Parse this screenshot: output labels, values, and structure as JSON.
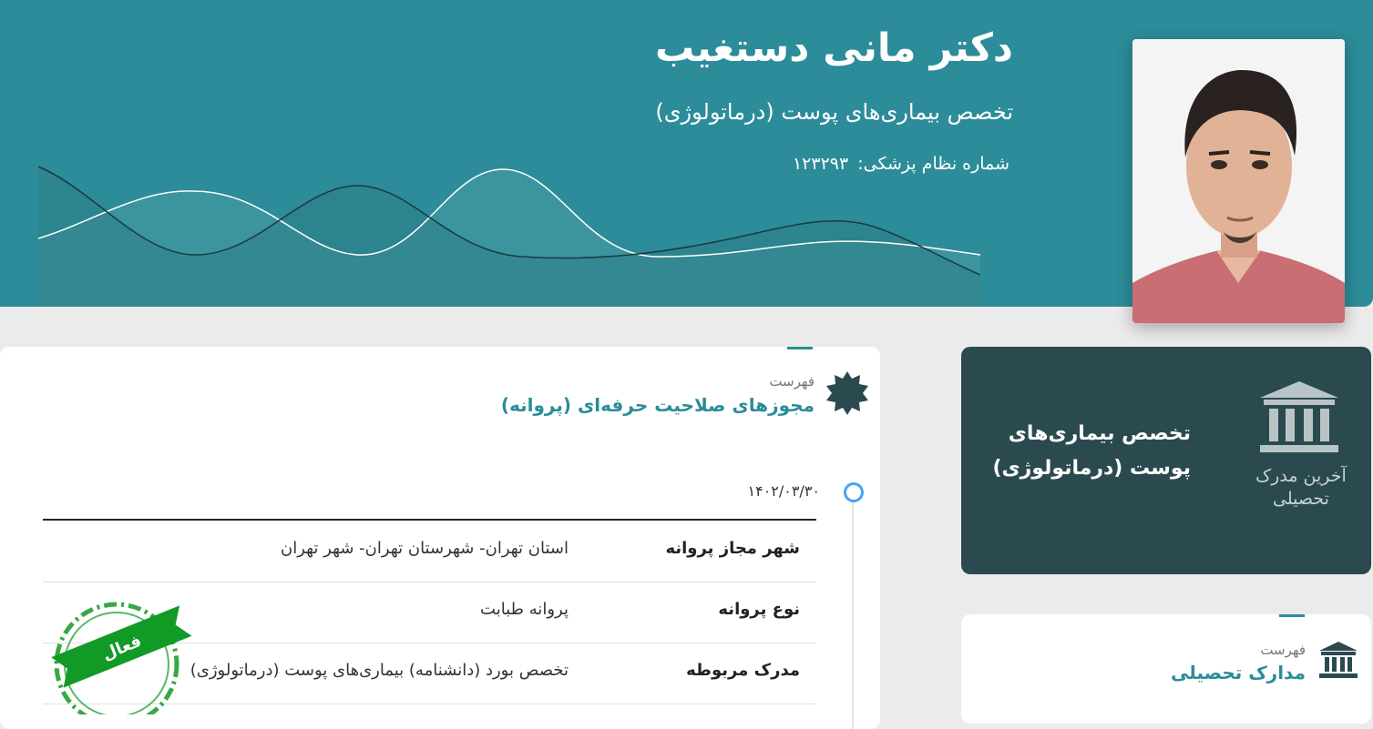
{
  "doctor": {
    "name": "دکتر مانی دستغیب",
    "specialty": "تخصص بیماری‌های پوست (درماتولوژی)",
    "reg_label": "شماره نظام پزشکی:",
    "reg_number": "۱۲۳۲۹۳"
  },
  "education_card": {
    "icon": "bank-icon",
    "label": "آخرین مدرک تحصیلی",
    "title": "تخصص بیماری‌های پوست (درماتولوژی)"
  },
  "license_section": {
    "kicker": "فهرست",
    "title": "مجوزهای صلاحیت حرفه‌ای (پروانه)",
    "icon": "badge-icon",
    "date": "۱۴۰۲/۰۳/۳۰",
    "rows": [
      {
        "key": "شهر مجاز پروانه",
        "value": "استان تهران- شهرستان تهران- شهر تهران"
      },
      {
        "key": "نوع پروانه",
        "value": "پروانه طبابت"
      },
      {
        "key": "مدرک مربوطه",
        "value": "تخصص بورد (دانشنامه) بیماری‌های پوست (درماتولوژی)"
      }
    ],
    "stamp_text": "فعال"
  },
  "degrees_section": {
    "kicker": "فهرست",
    "title": "مدارک تحصیلی",
    "icon": "bank-icon"
  },
  "colors": {
    "header": "#2c8c99",
    "dark_card": "#2b4a50",
    "stamp": "#129a26",
    "timeline_dot": "#4aa3f0"
  }
}
